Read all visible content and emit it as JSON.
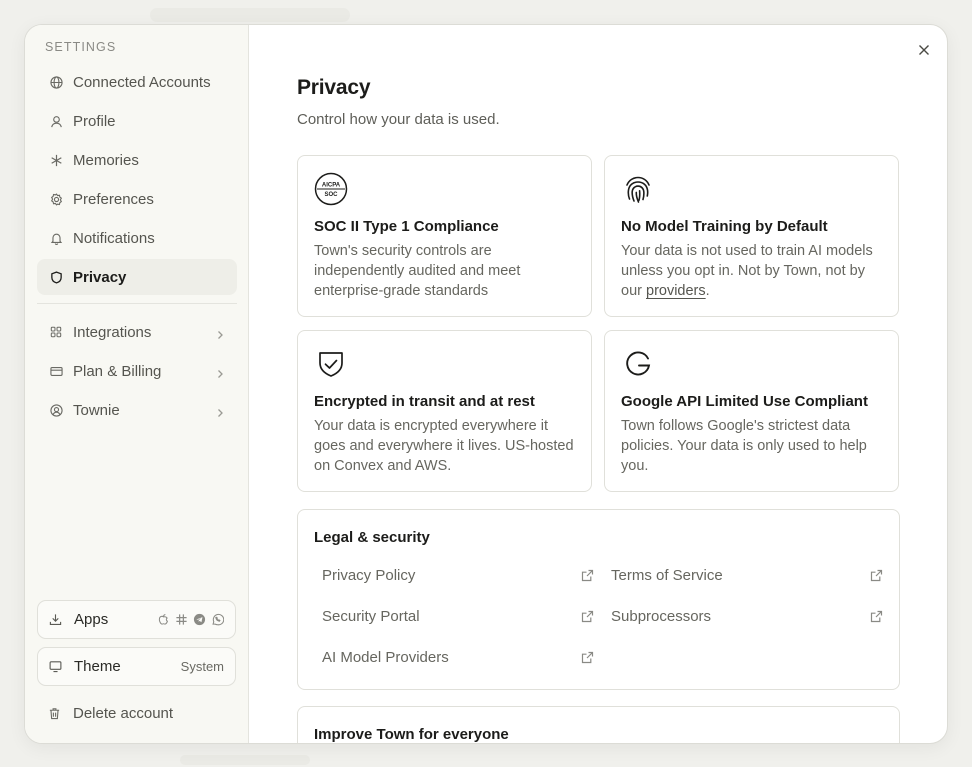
{
  "sidebar": {
    "heading": "SETTINGS",
    "items": [
      {
        "label": "Connected Accounts",
        "icon": "globe-icon"
      },
      {
        "label": "Profile",
        "icon": "user-icon"
      },
      {
        "label": "Memories",
        "icon": "asterisk-icon"
      },
      {
        "label": "Preferences",
        "icon": "gear-icon"
      },
      {
        "label": "Notifications",
        "icon": "bell-icon"
      },
      {
        "label": "Privacy",
        "icon": "shield-icon",
        "active": true
      }
    ],
    "groups": [
      {
        "label": "Integrations",
        "icon": "grid-icon"
      },
      {
        "label": "Plan & Billing",
        "icon": "card-icon"
      },
      {
        "label": "Townie",
        "icon": "townie-icon"
      }
    ],
    "apps": {
      "label": "Apps",
      "icons": [
        "apple-icon",
        "slack-icon",
        "telegram-icon",
        "whatsapp-icon"
      ]
    },
    "theme": {
      "label": "Theme",
      "value": "System"
    },
    "delete_label": "Delete account"
  },
  "main": {
    "title": "Privacy",
    "subtitle": "Control how your data is used.",
    "cards": [
      {
        "title": "SOC II Type 1 Compliance",
        "text": "Town's security controls are independently audited and meet enterprise-grade standards",
        "icon": "aicpa-soc-icon",
        "badge_top": "AICPA",
        "badge_bottom": "SOC"
      },
      {
        "title": "No Model Training by Default",
        "text_before": "Your data is not used to train AI models unless you opt in. Not by Town, not by our ",
        "link": "providers",
        "text_after": ".",
        "icon": "fingerprint-icon"
      },
      {
        "title": "Encrypted in transit and at rest",
        "text": "Your data is encrypted everywhere it goes and everywhere it lives. US-hosted on Convex and AWS.",
        "icon": "shield-check-icon"
      },
      {
        "title": "Google API Limited Use Compliant",
        "text": "Town follows Google's strictest data policies. Your data is only used to help you.",
        "icon": "google-icon"
      }
    ],
    "legal": {
      "title": "Legal & security",
      "links": [
        "Privacy Policy",
        "Terms of Service",
        "Security Portal",
        "Subprocessors",
        "AI Model Providers"
      ]
    },
    "improve": {
      "title": "Improve Town for everyone"
    }
  },
  "colors": {
    "accent": "#1c1c1a",
    "sidebar_bg": "#f8f8f3",
    "active_bg": "#eeeee8",
    "border": "#e0e0da"
  }
}
